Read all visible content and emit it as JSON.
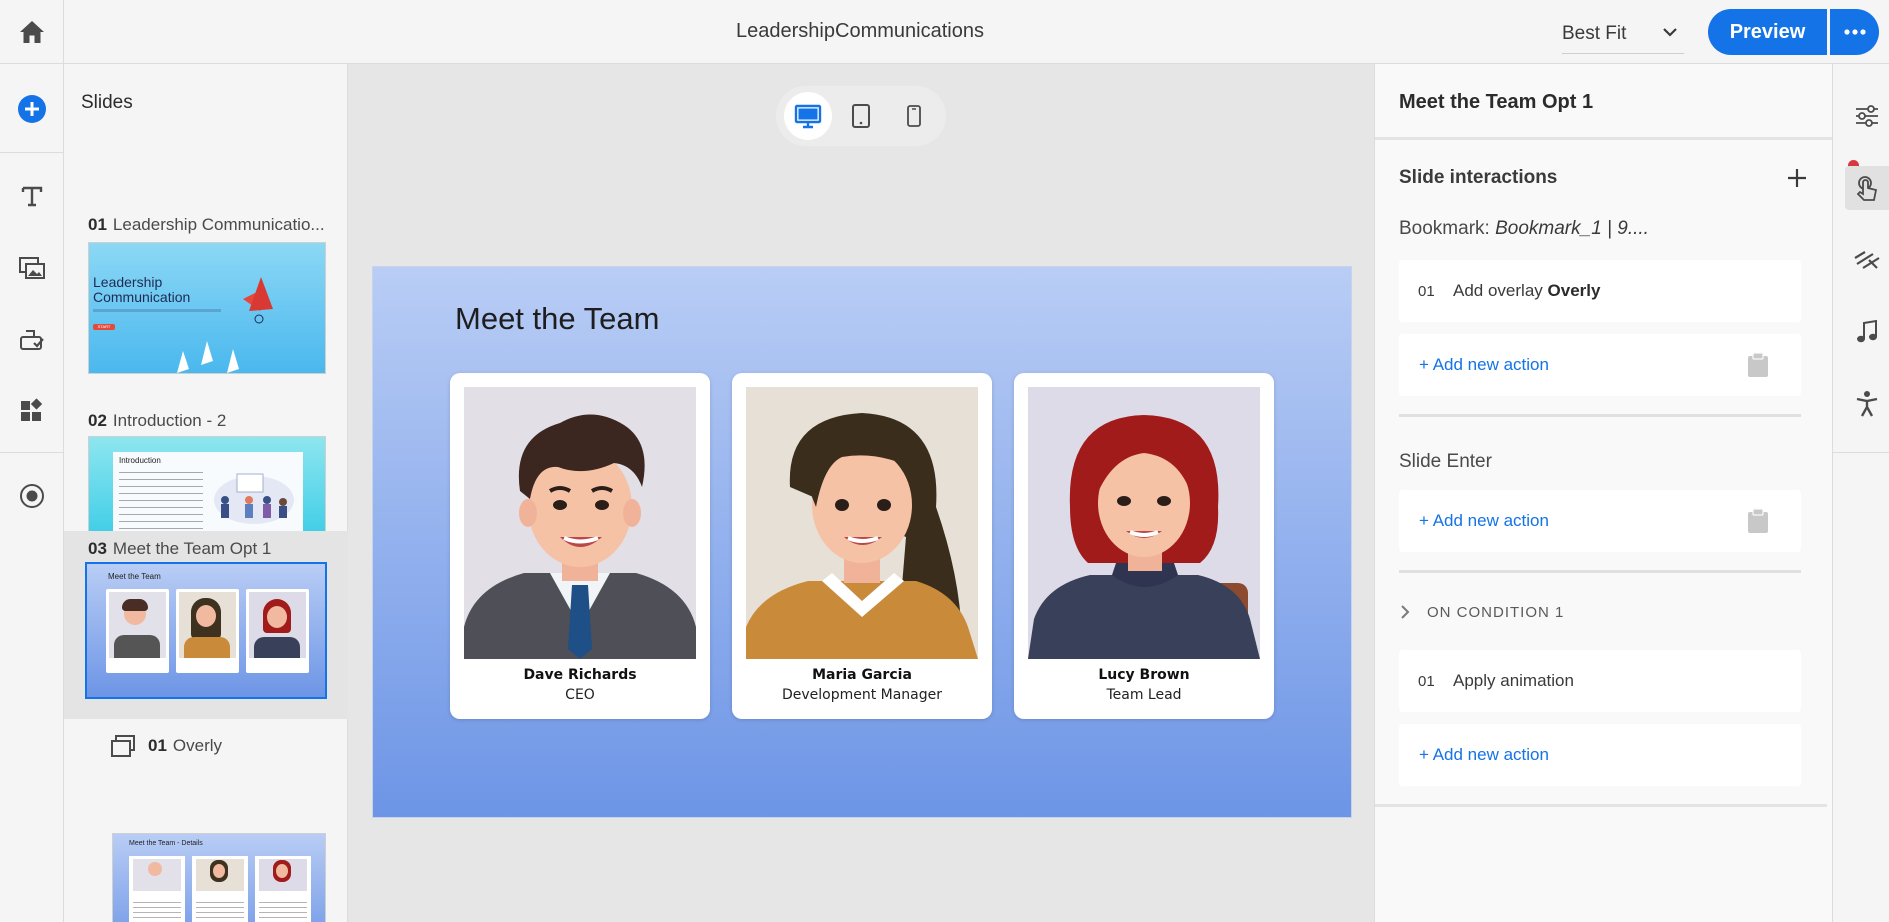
{
  "header": {
    "document_title": "LeadershipCommunications",
    "zoom": "Best Fit",
    "preview_label": "Preview"
  },
  "slides_panel": {
    "title": "Slides",
    "items": [
      {
        "number": "01",
        "title": "Leadership Communicatio...",
        "thumb_heading": "Leadership Communication",
        "thumb_button": "START"
      },
      {
        "number": "02",
        "title": "Introduction - 2",
        "thumb_heading": "Introduction"
      },
      {
        "number": "03",
        "title": "Meet the Team Opt 1",
        "thumb_heading": "Meet the Team"
      },
      {
        "number": "01",
        "title": "Overly",
        "thumb_heading": "Meet the Team - Details"
      }
    ]
  },
  "canvas": {
    "device_modes": [
      "desktop",
      "tablet",
      "mobile"
    ],
    "active_device": "desktop",
    "slide": {
      "heading": "Meet the Team",
      "team": [
        {
          "name": "Dave Richards",
          "role": "CEO"
        },
        {
          "name": "Maria Garcia",
          "role": "Development Manager"
        },
        {
          "name": "Lucy Brown",
          "role": "Team Lead"
        }
      ]
    }
  },
  "properties": {
    "title": "Meet the Team Opt 1",
    "slide_interactions_label": "Slide interactions",
    "bookmark_label": "Bookmark:",
    "bookmark_value": "Bookmark_1 | 9....",
    "bookmark_actions": [
      {
        "number": "01",
        "verb": "Add overlay",
        "target": "Overly"
      }
    ],
    "add_new_action": "+ Add new action",
    "slide_enter_label": "Slide Enter",
    "condition_label": "ON CONDITION 1",
    "condition_actions": [
      {
        "number": "01",
        "verb": "Apply animation"
      }
    ]
  },
  "colors": {
    "accent": "#1473e6",
    "notification": "#d7373f"
  }
}
